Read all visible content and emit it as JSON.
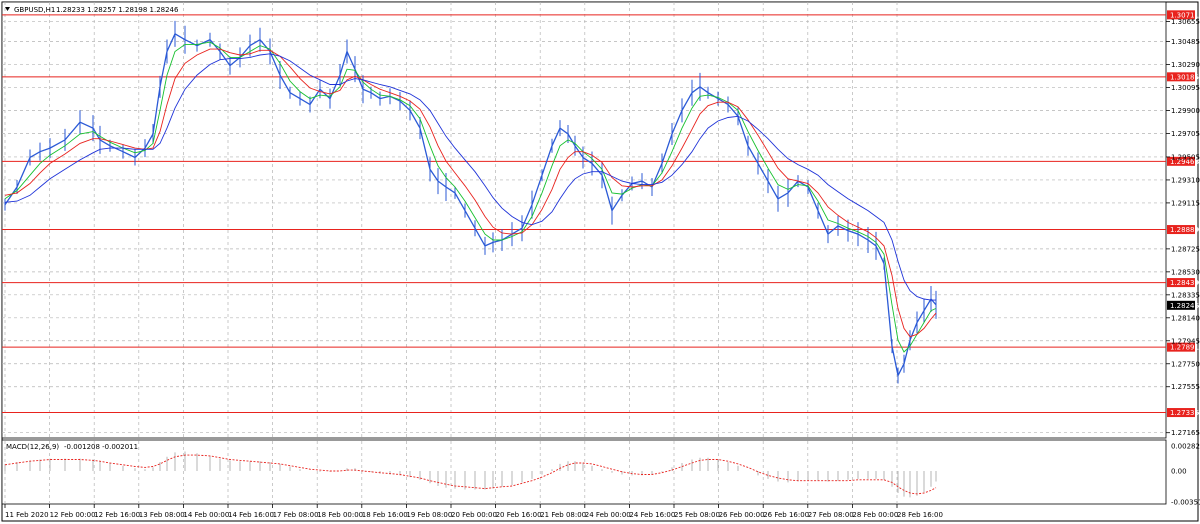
{
  "header": {
    "symbol": "GBPUSD,H1",
    "ohlc": "1.28233 1.28257 1.28198 1.28246"
  },
  "macd_header": {
    "label": "MACD(12,26,9)",
    "values": "-0.001208 -0.002011"
  },
  "colors": {
    "candles": "#2b5ad6",
    "ma_fast": "#16c02e",
    "ma_mid": "#e8231e",
    "ma_slow": "#1f33d8",
    "level_lines": "#e8231e",
    "macd_histogram": "#b4b4b4",
    "macd_signal": "#e8231e",
    "grid": "#b4b4b4",
    "price_badge": "#000000"
  },
  "chart_data": {
    "type": "line",
    "title": "GBPUSD,H1",
    "y_ticks": [
      "1.30655",
      "1.30485",
      "1.30290",
      "1.30095",
      "1.29900",
      "1.29705",
      "1.29505",
      "1.29310",
      "1.29115",
      "1.28725",
      "1.28530",
      "1.28335",
      "1.28140",
      "1.27945",
      "1.27750",
      "1.27555",
      "1.27165"
    ],
    "ylim": [
      1.2712,
      1.3082
    ],
    "x_ticks": [
      "11 Feb 2020",
      "12 Feb 00:00",
      "12 Feb 16:00",
      "13 Feb 08:00",
      "14 Feb 00:00",
      "14 Feb 16:00",
      "17 Feb 08:00",
      "18 Feb 00:00",
      "18 Feb 16:00",
      "19 Feb 08:00",
      "20 Feb 00:00",
      "20 Feb 16:00",
      "21 Feb 08:00",
      "24 Feb 00:00",
      "24 Feb 16:00",
      "25 Feb 08:00",
      "26 Feb 00:00",
      "26 Feb 16:00",
      "27 Feb 08:00",
      "28 Feb 00:00",
      "28 Feb 16:00"
    ],
    "horizontal_levels": [
      "1.30711",
      "1.30185",
      "1.29468",
      "1.28889",
      "1.28439",
      "1.27891",
      "1.27336"
    ],
    "current_price": "1.28246",
    "price_series": {
      "x": [
        0,
        12,
        25,
        35,
        45,
        60,
        75,
        88,
        95,
        105,
        118,
        130,
        140,
        148,
        155,
        162,
        170,
        180,
        192,
        205,
        215,
        225,
        235,
        245,
        255,
        265,
        275,
        285,
        295,
        305,
        315,
        325,
        335,
        342,
        350,
        358,
        366,
        375,
        385,
        395,
        405,
        415,
        425,
        433,
        441,
        450,
        460,
        470,
        480,
        488,
        497,
        507,
        517,
        527,
        537,
        547,
        555,
        563,
        570,
        578,
        587,
        597,
        607,
        617,
        627,
        637,
        647,
        657,
        667,
        677,
        687,
        695,
        703,
        713,
        723,
        733,
        743,
        753,
        763,
        773,
        783,
        793,
        803,
        813,
        823,
        833,
        843,
        853,
        863,
        871,
        879,
        887,
        893,
        899,
        905,
        912,
        919,
        926,
        931
      ],
      "y": [
        1.291,
        1.2925,
        1.295,
        1.2955,
        1.2958,
        1.2965,
        1.298,
        1.2975,
        1.2965,
        1.296,
        1.2955,
        1.295,
        1.2958,
        1.297,
        1.301,
        1.304,
        1.3055,
        1.305,
        1.3045,
        1.305,
        1.304,
        1.3028,
        1.3035,
        1.3045,
        1.305,
        1.304,
        1.302,
        1.3005,
        1.3,
        1.2995,
        1.3008,
        1.3,
        1.302,
        1.304,
        1.3025,
        1.3008,
        1.3005,
        1.3,
        1.3002,
        1.2998,
        1.299,
        1.2975,
        1.294,
        1.293,
        1.2925,
        1.292,
        1.2905,
        1.289,
        1.2875,
        1.2878,
        1.288,
        1.2885,
        1.289,
        1.291,
        1.2935,
        1.296,
        1.2975,
        1.297,
        1.296,
        1.295,
        1.2945,
        1.2935,
        1.2905,
        1.2918,
        1.2928,
        1.293,
        1.2925,
        1.2945,
        1.297,
        1.299,
        1.3005,
        1.301,
        1.3005,
        1.3,
        1.2995,
        1.2985,
        1.296,
        1.2945,
        1.293,
        1.2915,
        1.292,
        1.293,
        1.2925,
        1.2905,
        1.2885,
        1.2892,
        1.2888,
        1.2885,
        1.288,
        1.2875,
        1.286,
        1.279,
        1.2765,
        1.2775,
        1.2795,
        1.281,
        1.282,
        1.283,
        1.2825
      ]
    },
    "series": [
      {
        "values": [
          1.2915,
          1.2922,
          1.2935,
          1.2945,
          1.2952,
          1.296,
          1.297,
          1.2972,
          1.2968,
          1.2963,
          1.2958,
          1.2954,
          1.2956,
          1.2962,
          1.299,
          1.302,
          1.304,
          1.3046,
          1.3046,
          1.3048,
          1.3043,
          1.3035,
          1.3035,
          1.304,
          1.3045,
          1.3042,
          1.303,
          1.3015,
          1.3006,
          1.3,
          1.3003,
          1.3002,
          1.301,
          1.3025,
          1.3024,
          1.3014,
          1.3008,
          1.3003,
          1.3002,
          1.2999,
          1.2994,
          1.2983,
          1.296,
          1.2943,
          1.2933,
          1.2925,
          1.2913,
          1.2899,
          1.2885,
          1.288,
          1.288,
          1.2883,
          1.2887,
          1.29,
          1.292,
          1.2943,
          1.296,
          1.2965,
          1.2962,
          1.2955,
          1.2949,
          1.294,
          1.292,
          1.2919,
          1.2924,
          1.2927,
          1.2926,
          1.2937,
          1.2955,
          1.2975,
          1.2992,
          1.3002,
          1.3003,
          1.3001,
          1.2997,
          1.299,
          1.2972,
          1.2956,
          1.2941,
          1.2927,
          1.2923,
          1.2927,
          1.2926,
          1.2913,
          1.2897,
          1.2894,
          1.289,
          1.2887,
          1.2883,
          1.2878,
          1.2868,
          1.2825,
          1.2795,
          1.2785,
          1.279,
          1.28,
          1.281,
          1.282,
          1.2822
        ]
      },
      {
        "values": [
          1.2918,
          1.292,
          1.2928,
          1.2937,
          1.2945,
          1.2953,
          1.2962,
          1.2966,
          1.2966,
          1.2964,
          1.2961,
          1.2958,
          1.2957,
          1.2958,
          1.2972,
          1.2995,
          1.3017,
          1.303,
          1.3037,
          1.3042,
          1.3042,
          1.3039,
          1.3037,
          1.3038,
          1.3041,
          1.3041,
          1.3036,
          1.3027,
          1.3017,
          1.3009,
          1.3006,
          1.3004,
          1.3007,
          1.3016,
          1.3019,
          1.3016,
          1.3012,
          1.3008,
          1.3005,
          1.3002,
          1.2998,
          1.2991,
          1.2976,
          1.296,
          1.2947,
          1.2937,
          1.2926,
          1.2914,
          1.29,
          1.2891,
          1.2886,
          1.2885,
          1.2886,
          1.2893,
          1.2906,
          1.2923,
          1.294,
          1.295,
          1.2955,
          1.2955,
          1.2952,
          1.2946,
          1.2933,
          1.2926,
          1.2925,
          1.2926,
          1.2926,
          1.2931,
          1.2943,
          1.2958,
          1.2974,
          1.2987,
          1.2994,
          1.2997,
          1.2997,
          1.2993,
          1.2982,
          1.2969,
          1.2955,
          1.2941,
          1.2932,
          1.293,
          1.2928,
          1.292,
          1.2908,
          1.2901,
          1.2895,
          1.2891,
          1.2887,
          1.2882,
          1.2875,
          1.285,
          1.2822,
          1.2805,
          1.2798,
          1.28,
          1.2805,
          1.2813,
          1.2818
        ]
      },
      {
        "values": [
          1.2912,
          1.2913,
          1.2918,
          1.2925,
          1.2932,
          1.294,
          1.2948,
          1.2954,
          1.2957,
          1.2958,
          1.2958,
          1.2957,
          1.2957,
          1.2957,
          1.2962,
          1.2975,
          1.2992,
          1.3008,
          1.302,
          1.3029,
          1.3033,
          1.3034,
          1.3034,
          1.3035,
          1.3037,
          1.3038,
          1.3036,
          1.3032,
          1.3026,
          1.302,
          1.3016,
          1.3012,
          1.3012,
          1.3015,
          1.3017,
          1.3016,
          1.3014,
          1.3012,
          1.301,
          1.3007,
          1.3004,
          1.2999,
          1.299,
          1.2979,
          1.2968,
          1.2958,
          1.2948,
          1.2938,
          1.2926,
          1.2916,
          1.2907,
          1.29,
          1.2895,
          1.2893,
          1.2896,
          1.2904,
          1.2915,
          1.2925,
          1.2932,
          1.2936,
          1.2938,
          1.2938,
          1.2934,
          1.293,
          1.2928,
          1.2927,
          1.2927,
          1.2929,
          1.2935,
          1.2944,
          1.2955,
          1.2966,
          1.2975,
          1.2981,
          1.2984,
          1.2985,
          1.2981,
          1.2974,
          1.2966,
          1.2957,
          1.2949,
          1.2944,
          1.294,
          1.2935,
          1.2927,
          1.2921,
          1.2915,
          1.291,
          1.2905,
          1.29,
          1.2895,
          1.288,
          1.2862,
          1.2846,
          1.2837,
          1.2832,
          1.283,
          1.2829,
          1.2829
        ]
      }
    ],
    "macd": {
      "y_ticks": [
        "0.002827",
        "0.00",
        "-0.003517"
      ],
      "ylim": [
        -0.003517,
        0.002827
      ],
      "histogram": [
        0.0008,
        0.001,
        0.0012,
        0.0013,
        0.0014,
        0.0014,
        0.0014,
        0.0013,
        0.0011,
        0.0009,
        0.0006,
        0.0003,
        0.0002,
        0.0004,
        0.001,
        0.0016,
        0.0021,
        0.0022,
        0.002,
        0.0017,
        0.0014,
        0.0012,
        0.0011,
        0.0011,
        0.0011,
        0.001,
        0.0008,
        0.0005,
        0.0002,
        0.0,
        -0.0001,
        -0.0001,
        0.0,
        0.0003,
        0.0003,
        0.0001,
        -0.0001,
        -0.0003,
        -0.0004,
        -0.0005,
        -0.0007,
        -0.001,
        -0.0014,
        -0.0017,
        -0.0019,
        -0.002,
        -0.0021,
        -0.0021,
        -0.0021,
        -0.002,
        -0.0018,
        -0.0016,
        -0.0013,
        -0.0009,
        -0.0004,
        0.0002,
        0.0008,
        0.0011,
        0.0011,
        0.0009,
        0.0006,
        0.0002,
        -0.0002,
        -0.0004,
        -0.0005,
        -0.0005,
        -0.0004,
        -0.0001,
        0.0004,
        0.0009,
        0.0013,
        0.0015,
        0.0015,
        0.0013,
        0.001,
        0.0006,
        0.0,
        -0.0005,
        -0.0009,
        -0.0012,
        -0.0013,
        -0.0012,
        -0.0011,
        -0.0011,
        -0.0012,
        -0.0011,
        -0.001,
        -0.0009,
        -0.0009,
        -0.0009,
        -0.001,
        -0.0018,
        -0.0025,
        -0.0029,
        -0.003,
        -0.0028,
        -0.0024,
        -0.0018,
        -0.0012
      ],
      "signal": [
        0.0007,
        0.0009,
        0.0011,
        0.0012,
        0.0013,
        0.0013,
        0.0013,
        0.0012,
        0.0011,
        0.0009,
        0.0007,
        0.0005,
        0.0004,
        0.0005,
        0.0008,
        0.0012,
        0.0016,
        0.0018,
        0.0018,
        0.0017,
        0.0015,
        0.0013,
        0.0012,
        0.0011,
        0.001,
        0.0009,
        0.0008,
        0.0006,
        0.0004,
        0.0002,
        0.0001,
        0.0,
        0.0,
        0.0001,
        0.0001,
        0.0,
        -0.0001,
        -0.0002,
        -0.0003,
        -0.0004,
        -0.0006,
        -0.0008,
        -0.0011,
        -0.0013,
        -0.0015,
        -0.0017,
        -0.0018,
        -0.0019,
        -0.002,
        -0.0019,
        -0.0018,
        -0.0017,
        -0.0014,
        -0.0011,
        -0.0007,
        -0.0002,
        0.0003,
        0.0007,
        0.0009,
        0.0009,
        0.0008,
        0.0005,
        0.0002,
        -0.0001,
        -0.0003,
        -0.0004,
        -0.0004,
        -0.0002,
        0.0001,
        0.0005,
        0.0009,
        0.0012,
        0.0013,
        0.0013,
        0.0011,
        0.0008,
        0.0004,
        -0.0001,
        -0.0005,
        -0.0008,
        -0.001,
        -0.0011,
        -0.0011,
        -0.0011,
        -0.0011,
        -0.0011,
        -0.0011,
        -0.001,
        -0.001,
        -0.001,
        -0.001,
        -0.0013,
        -0.0018,
        -0.0022,
        -0.0025,
        -0.0026,
        -0.0025,
        -0.0022,
        -0.0019
      ]
    }
  }
}
